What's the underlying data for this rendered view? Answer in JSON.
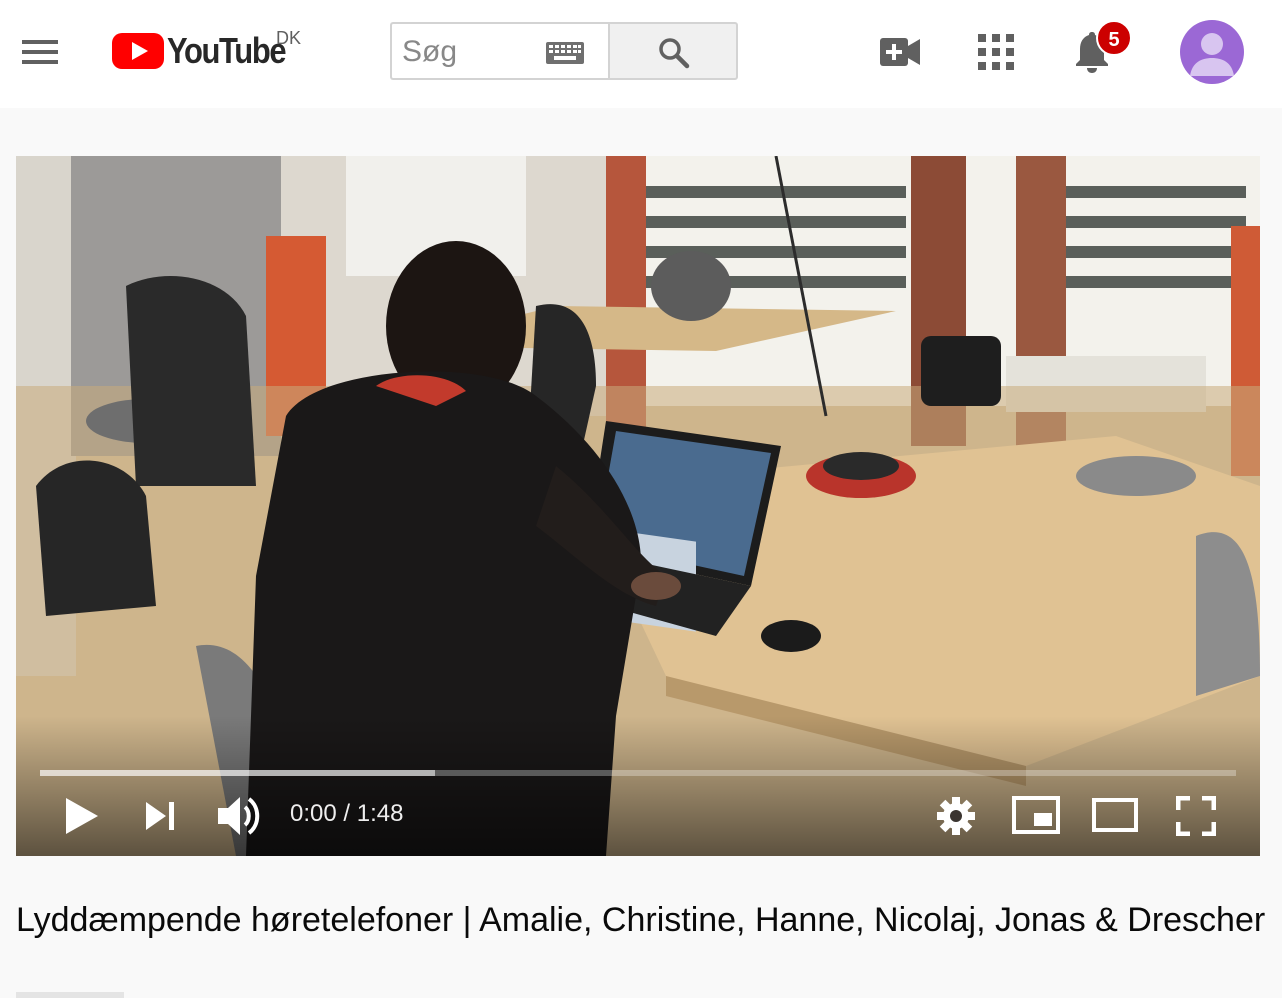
{
  "header": {
    "menu_label": "Menu",
    "logo_text": "YouTube",
    "logo_country": "DK",
    "search": {
      "placeholder": "Søg",
      "value": ""
    },
    "icons": [
      "menu-icon",
      "youtube-logo",
      "keyboard-icon",
      "search-icon",
      "create-video-icon",
      "apps-grid-icon",
      "notifications-bell-icon",
      "avatar"
    ],
    "notifications_count": "5",
    "colors": {
      "brand_red": "#ff0000",
      "badge_red": "#cc0000",
      "avatar_purple": "#9b68d5"
    }
  },
  "player": {
    "current_time": "0:00",
    "separator": "/",
    "duration": "1:48",
    "loaded_fraction": 0.33,
    "played_fraction": 0.0,
    "controls": [
      "play-icon",
      "next-icon",
      "volume-icon",
      "settings-gear-icon",
      "miniplayer-icon",
      "theater-mode-icon",
      "fullscreen-icon"
    ]
  },
  "video": {
    "title": "Lyddæmpende høretelefoner | Amalie, Christine, Hanne, Nicolaj, Jonas & Drescher"
  }
}
